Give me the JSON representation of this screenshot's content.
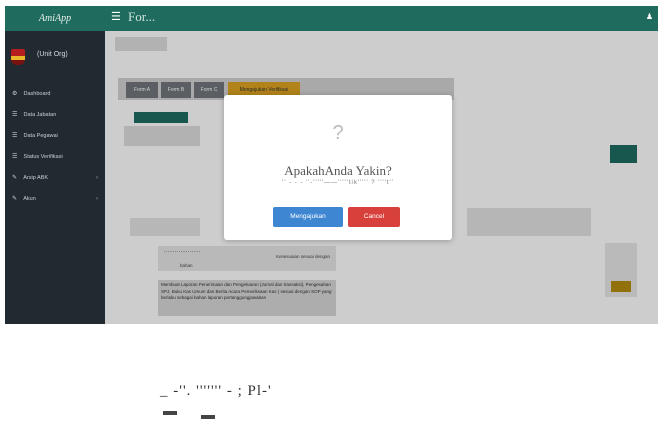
{
  "brand": "AmiApp",
  "topbar": {
    "page_title": "For..."
  },
  "sidebar": {
    "user": "(Unit Org)",
    "items": [
      {
        "icon": "dashboard-icon",
        "glyph": "⚙",
        "label": "Dashboard"
      },
      {
        "icon": "list-icon",
        "glyph": "☰",
        "label": "Data Jabatan"
      },
      {
        "icon": "list-icon",
        "glyph": "☰",
        "label": "Data Pegawai"
      },
      {
        "icon": "list-icon",
        "glyph": "☰",
        "label": "Status Verifikasi"
      },
      {
        "icon": "edit-icon",
        "glyph": "✎",
        "label": "Arsip ABK",
        "has_submenu": true
      },
      {
        "icon": "edit-icon",
        "glyph": "✎",
        "label": "Akun",
        "has_submenu": true
      }
    ]
  },
  "tabs": [
    "Form A",
    "Form B",
    "Form C",
    "Mengajukan Verifikasi"
  ],
  "keterangan": {
    "line1": "''''''''''''''''''''",
    "line2": "Kesesuaian sesuai dengan",
    "line3": "bahan"
  },
  "description": "Membuat Laporan Penerimaan dan Pengeluaran (Jurnal dan transaksi), Pengesahan SPJ, Buku Kas Umum dan Berita Acara Pemeriksaan Kas ( sesuai dengan SOP yang berlaku sebagai bahan laporan pertanggungjawaban",
  "modal": {
    "icon": "?",
    "title": "ApakahAnda Yakin?",
    "text": "'' - - - ''-'''''——'''''tik''''' ? ''''t''",
    "confirm_label": "Mengajukan",
    "cancel_label": "Cancel"
  },
  "footer_text": "_ -''. ''''''' - ; Pl-'",
  "colors": {
    "primary": "#1f6b5d",
    "sidebar": "#202a30",
    "confirm": "#3e86d1",
    "cancel": "#d8413b",
    "active_tab": "#d9a020"
  }
}
